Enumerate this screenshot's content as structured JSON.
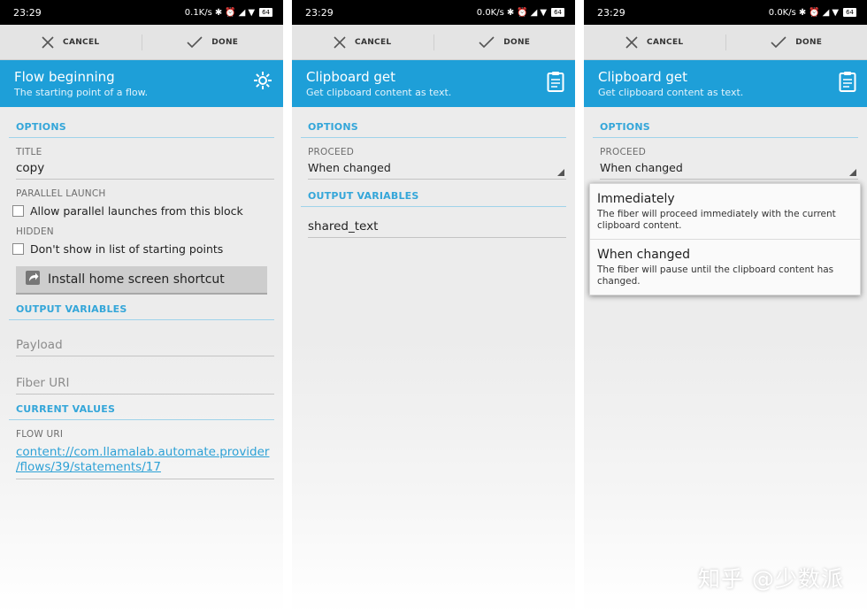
{
  "status": {
    "time": "23:29"
  },
  "actionbar": {
    "cancel_label": "CANCEL",
    "done_label": "DONE"
  },
  "screen1": {
    "header": {
      "title": "Flow beginning",
      "subtitle": "The starting point of a flow."
    },
    "section_options": "OPTIONS",
    "title_label": "TITLE",
    "title_value": "copy",
    "parallel_label": "PARALLEL LAUNCH",
    "parallel_checkbox": "Allow parallel launches from this block",
    "hidden_label": "HIDDEN",
    "hidden_checkbox": "Don't show in list of starting points",
    "shortcut_button": "Install home screen shortcut",
    "section_output": "OUTPUT VARIABLES",
    "payload_placeholder": "Payload",
    "fiber_placeholder": "Fiber URI",
    "section_current": "CURRENT VALUES",
    "flow_uri_label": "FLOW URI",
    "flow_uri_line1": "content://com.llamalab.automate.provider",
    "flow_uri_line2": "/flows/39/statements/17",
    "network_speed": "0.1K/s"
  },
  "screen2": {
    "header": {
      "title": "Clipboard get",
      "subtitle": "Get clipboard content as text."
    },
    "section_options": "OPTIONS",
    "proceed_label": "PROCEED",
    "proceed_value": "When changed",
    "section_output": "OUTPUT VARIABLES",
    "output_value": "shared_text",
    "network_speed": "0.0K/s"
  },
  "screen3": {
    "header": {
      "title": "Clipboard get",
      "subtitle": "Get clipboard content as text."
    },
    "section_options": "OPTIONS",
    "proceed_label": "PROCEED",
    "proceed_value": "When changed",
    "network_speed": "0.0K/s",
    "dropdown": [
      {
        "title": "Immediately",
        "desc": "The fiber will proceed immediately with the current clipboard content."
      },
      {
        "title": "When changed",
        "desc": "The fiber will pause until the clipboard content has changed."
      }
    ]
  },
  "battery": "64",
  "watermark": "知乎 @少数派",
  "colors": {
    "accent": "#1e9fd8",
    "section": "#34a6d9",
    "link": "#2da1d6",
    "statusbar": "#000000"
  },
  "icons": [
    "close-icon",
    "check-icon",
    "gear-icon",
    "clipboard-icon",
    "shortcut-arrow-icon",
    "bluetooth-icon",
    "alarm-icon",
    "signal-icon",
    "wifi-icon",
    "battery-icon"
  ]
}
